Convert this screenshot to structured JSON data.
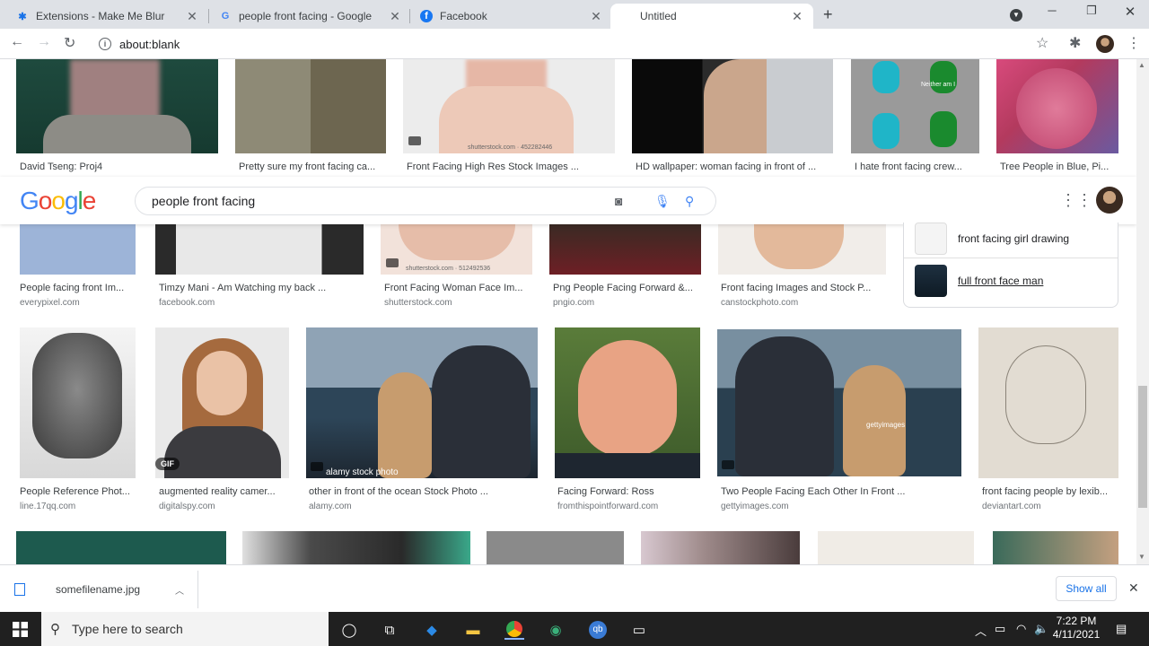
{
  "tabs": [
    {
      "title": "Extensions - Make Me Blur",
      "icon": "puzzle-icon",
      "active": false
    },
    {
      "title": "people front facing - Google Sea",
      "icon": "google-icon",
      "active": false
    },
    {
      "title": "Facebook",
      "icon": "facebook-icon",
      "active": false
    },
    {
      "title": "Untitled",
      "icon": "",
      "active": true
    }
  ],
  "address": {
    "url": "about:blank"
  },
  "google": {
    "logo": "Google",
    "query": "people front facing"
  },
  "row1": [
    {
      "caption": "David Tseng: Proj4"
    },
    {
      "caption": "Pretty sure my front facing ca..."
    },
    {
      "caption": "Front Facing High Res Stock Images ..."
    },
    {
      "caption": "HD wallpaper: woman facing in front of ..."
    },
    {
      "caption": "I hate front facing crew..."
    },
    {
      "caption": "Tree People in Blue, Pi..."
    }
  ],
  "row2": [
    {
      "caption": "People facing front Im...",
      "source": "everypixel.com"
    },
    {
      "caption": "Timzy Mani - Am Watching my back ...",
      "source": "facebook.com"
    },
    {
      "caption": "Front Facing Woman Face Im...",
      "source": "shutterstock.com"
    },
    {
      "caption": "Png People Facing Forward &...",
      "source": "pngio.com"
    },
    {
      "caption": "Front facing Images and Stock P...",
      "source": "canstockphoto.com"
    }
  ],
  "row3": [
    {
      "caption": "People Reference Phot...",
      "source": "line.17qq.com"
    },
    {
      "caption": "augmented reality camer...",
      "source": "digitalspy.com",
      "badge": "GIF"
    },
    {
      "caption": "other in front of the ocean Stock Photo ...",
      "source": "alamy.com"
    },
    {
      "caption": "Facing Forward: Ross",
      "source": "fromthispointforward.com"
    },
    {
      "caption": "Two People Facing Each Other In Front ...",
      "source": "gettyimages.com"
    },
    {
      "caption": "front facing people by lexib...",
      "source": "deviantart.com"
    }
  ],
  "overlays": {
    "alamy": "alamy stock photo",
    "shutter1": "shutterstock.com · 452282446",
    "shutter2": "shutterstock.com · 512492536",
    "getty": "gettyimages",
    "amongus": "Neither am I"
  },
  "related": [
    {
      "label": "front facing girl drawing"
    },
    {
      "label": "full front face man"
    }
  ],
  "download": {
    "filename": "somefilename.jpg",
    "show_all": "Show all"
  },
  "taskbar": {
    "search_placeholder": "Type here to search",
    "time": "7:22 PM",
    "date": "4/11/2021"
  }
}
